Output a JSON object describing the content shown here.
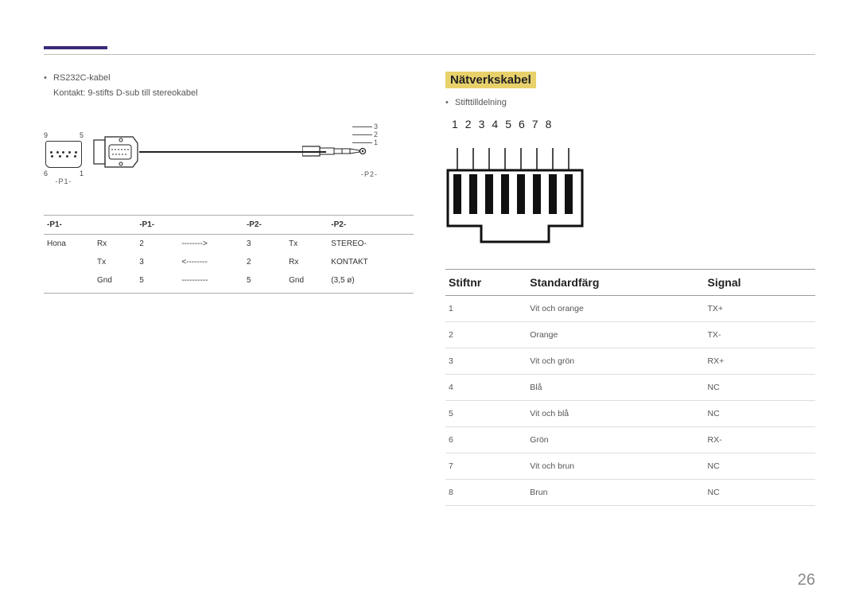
{
  "left": {
    "cable_title": "RS232C-kabel",
    "cable_subtitle": "Kontakt: 9-stifts D-sub till stereokabel",
    "dsub": {
      "tl": "9",
      "tr": "5",
      "bl": "6",
      "br": "1",
      "label": "-P1-"
    },
    "plug": {
      "n3": "3",
      "n2": "2",
      "n1": "1",
      "label": "-P2-"
    },
    "table": {
      "headers": [
        "-P1-",
        "",
        "-P1-",
        "",
        "-P2-",
        "",
        "-P2-"
      ],
      "rows": [
        [
          "Hona",
          "Rx",
          "2",
          "-------->",
          "3",
          "Tx",
          "STEREO-"
        ],
        [
          "",
          "Tx",
          "3",
          "<--------",
          "2",
          "Rx",
          "KONTAKT"
        ],
        [
          "",
          "Gnd",
          "5",
          "----------",
          "5",
          "Gnd",
          "(3,5 ø)"
        ]
      ]
    }
  },
  "right": {
    "section_title": "Nätverkskabel",
    "bullet": "Stifttilldelning",
    "pins": [
      "1",
      "2",
      "3",
      "4",
      "5",
      "6",
      "7",
      "8"
    ],
    "table": {
      "headers": [
        "Stiftnr",
        "Standardfärg",
        "Signal"
      ],
      "rows": [
        [
          "1",
          "Vit och orange",
          "TX+"
        ],
        [
          "2",
          "Orange",
          "TX-"
        ],
        [
          "3",
          "Vit och grön",
          "RX+"
        ],
        [
          "4",
          "Blå",
          "NC"
        ],
        [
          "5",
          "Vit och blå",
          "NC"
        ],
        [
          "6",
          "Grön",
          "RX-"
        ],
        [
          "7",
          "Vit och brun",
          "NC"
        ],
        [
          "8",
          "Brun",
          "NC"
        ]
      ]
    }
  },
  "page_number": "26"
}
